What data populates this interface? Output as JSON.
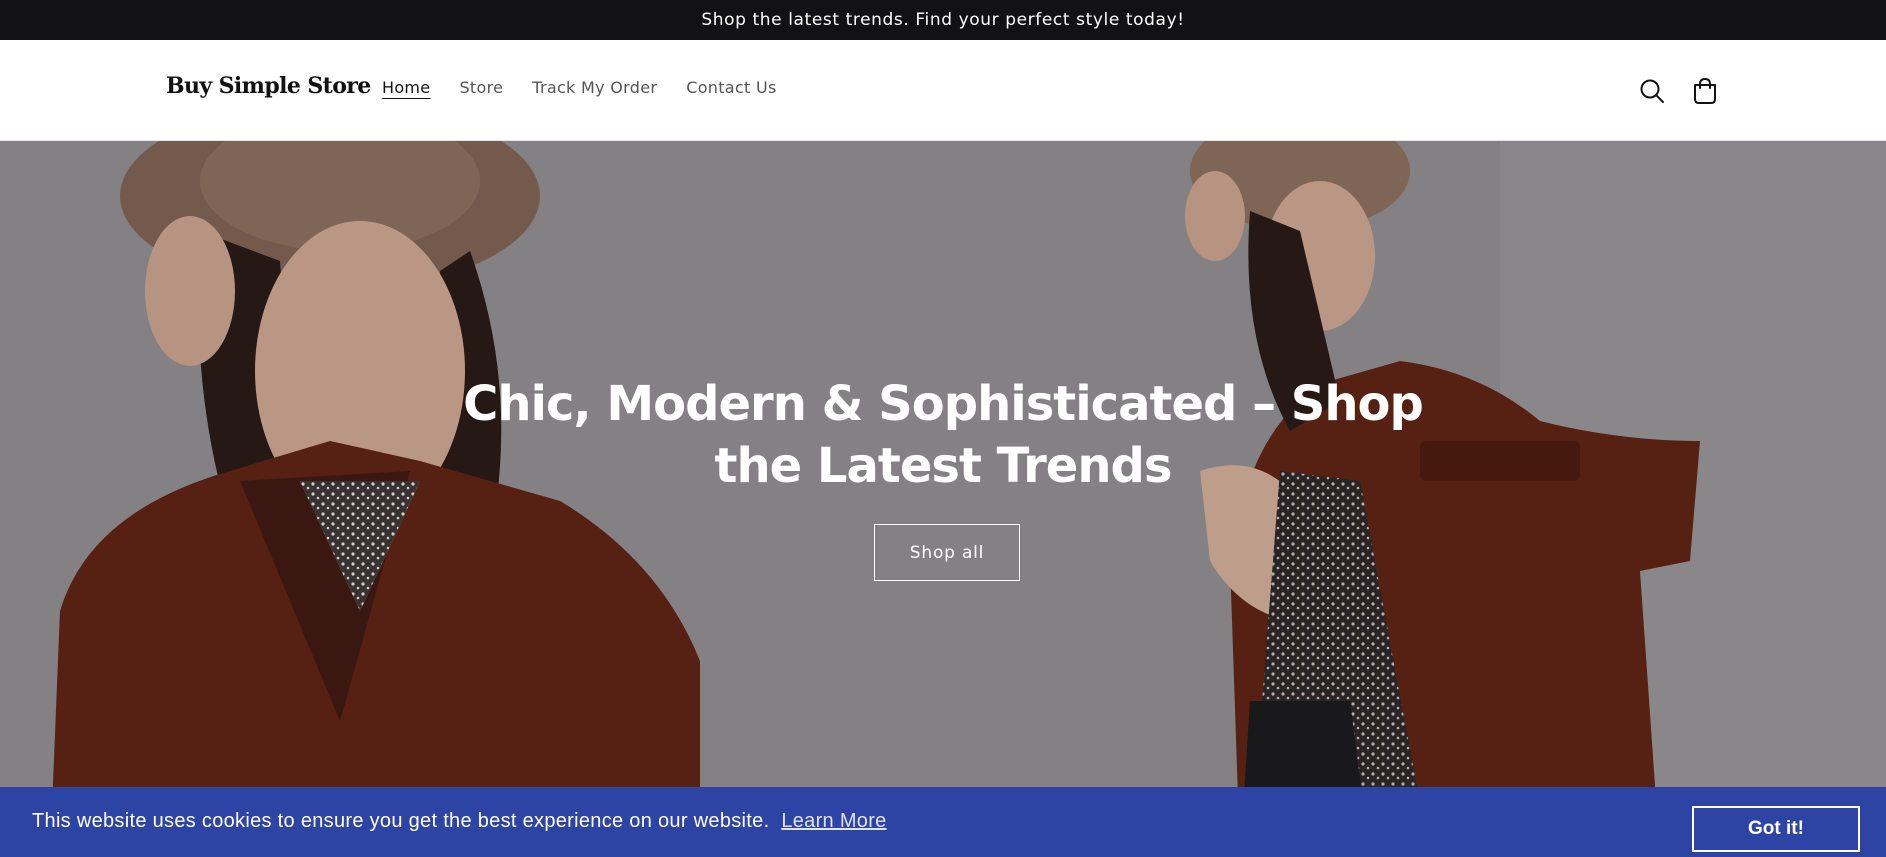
{
  "announcement": {
    "text": "Shop the latest trends. Find your perfect style today!"
  },
  "header": {
    "logo": "Buy Simple Store",
    "nav": [
      {
        "label": "Home",
        "active": true
      },
      {
        "label": "Store",
        "active": false
      },
      {
        "label": "Track My Order",
        "active": false
      },
      {
        "label": "Contact Us",
        "active": false
      }
    ],
    "icons": {
      "search": "search-icon",
      "cart": "cart-icon"
    }
  },
  "hero": {
    "headline": "Chic, Modern & Sophisticated – Shop the Latest Trends",
    "button_label": "Shop all",
    "image": "two-models-brown-trench-coats-and-hats"
  },
  "cookie_banner": {
    "message": "This website uses cookies to ensure you get the best experience on our website.",
    "link_label": "Learn More",
    "button_label": "Got it!"
  },
  "colors": {
    "announcement_bg": "#121216",
    "cookie_bg": "#2e44a5",
    "hero_bg": "#908d91",
    "coat": "#5e2314"
  }
}
